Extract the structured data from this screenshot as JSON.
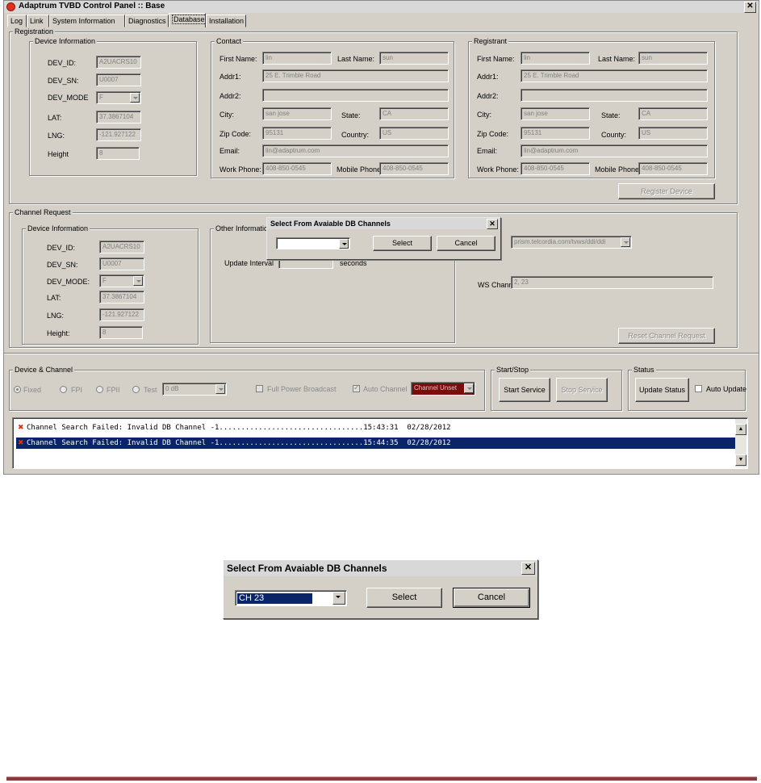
{
  "window": {
    "title": "Adaptrum TVBD Control Panel :: Base",
    "close_glyph": "✕",
    "tabs": [
      {
        "label": "Log",
        "active": false
      },
      {
        "label": "Link",
        "active": false
      },
      {
        "label": "System Information",
        "active": false
      },
      {
        "label": "Diagnostics",
        "active": false
      },
      {
        "label": "Database",
        "active": true
      },
      {
        "label": "Installation",
        "active": false
      }
    ]
  },
  "registration": {
    "group_label": "Registration",
    "device_info": {
      "label": "Device Information",
      "fields": [
        {
          "label": "DEV_ID:",
          "value": "A2UACRS10"
        },
        {
          "label": "DEV_SN:",
          "value": "U0007"
        },
        {
          "label": "DEV_MODE",
          "value": "F"
        },
        {
          "label": "LAT:",
          "value": "37.3867104"
        },
        {
          "label": "LNG:",
          "value": "-121.927122"
        },
        {
          "label": "Height",
          "value": "8"
        }
      ]
    },
    "contact": {
      "label": "Contact",
      "first_name_label": "First Name:",
      "first_name": "lin",
      "last_name_label": "Last Name:",
      "last_name": "sun",
      "addr1_label": "Addr1:",
      "addr1": "25 E. Trimble Road",
      "addr2_label": "Addr2:",
      "addr2": "",
      "city_label": "City:",
      "city": "san jose",
      "state_label": "State:",
      "state": "CA",
      "zip_label": "Zip Code:",
      "zip": "95131",
      "country_label": "Country:",
      "country": "US",
      "email_label": "Email:",
      "email": "lin@adaptrum.com",
      "work_phone_label": "Work Phone:",
      "work_phone": "408-850-0545",
      "mobile_phone_label": "Mobile Phone:",
      "mobile_phone": "408-850-0545"
    },
    "registrant": {
      "label": "Registrant",
      "first_name_label": "First Name:",
      "first_name": "lin",
      "last_name_label": "Last Name:",
      "last_name": "sun",
      "addr1_label": "Addr1:",
      "addr1": "25 E. Trimble Road",
      "addr2_label": "Addr2:",
      "addr2": "",
      "city_label": "City:",
      "city": "san jose",
      "state_label": "State:",
      "state": "CA",
      "zip_label": "Zip Code:",
      "zip": "95131",
      "country_label": "County:",
      "country": "US",
      "email_label": "Email:",
      "email": "lin@adaptrum.com",
      "work_phone_label": "Work Phone:",
      "work_phone": "408-850-0545",
      "mobile_phone_label": "Mobile Phone:",
      "mobile_phone": "408-850-0545"
    },
    "register_button": "Register Device"
  },
  "channel_request": {
    "group_label": "Channel Request",
    "device_info": {
      "label": "Device Information",
      "fields": [
        {
          "label": "DEV_ID:",
          "value": "A2UACRS10"
        },
        {
          "label": "DEV_SN:",
          "value": "U0007"
        },
        {
          "label": "DEV_MODE:",
          "value": "F"
        },
        {
          "label": "LAT:",
          "value": "37.3867104"
        },
        {
          "label": "LNG:",
          "value": "-121.927122"
        },
        {
          "label": "Height:",
          "value": "8"
        }
      ]
    },
    "other_info_label": "Other Information",
    "update_interval_label": "Update Interval",
    "update_interval_unit": "seconds",
    "db_url": "prism.telcordia.com/tvws/ddi/ddi",
    "ws_channels_label": "WS Channels:",
    "ws_channels": "2, 23",
    "reset_button": "Reset Channel Request"
  },
  "popup_small": {
    "title": "Select From Avaiable DB Channels",
    "select_value": "",
    "select_button": "Select",
    "cancel_button": "Cancel"
  },
  "device_channel": {
    "group_label": "Device & Channel",
    "radios": [
      "Fixed",
      "FPI",
      "FPII",
      "Test"
    ],
    "selected_radio": "Fixed",
    "power": "0 dB",
    "full_power_label": "Full Power Broadcast",
    "auto_channel_label": "Auto Channel",
    "channel_value": "Channel Unset"
  },
  "start_stop": {
    "group_label": "Start/Stop",
    "start_button": "Start Service",
    "stop_button": "Stop Service"
  },
  "status": {
    "group_label": "Status",
    "update_button": "Update Status",
    "auto_update_label": "Auto Update"
  },
  "log": {
    "rows": [
      {
        "text": "Channel Search Failed: Invalid DB Channel -1.................................15:43:31  02/28/2012",
        "selected": false
      },
      {
        "text": "Channel Search Failed: Invalid DB Channel -1.................................15:44:35  02/28/2012",
        "selected": true
      }
    ]
  },
  "popup_large": {
    "title": "Select From Avaiable DB Channels",
    "select_value": "CH 23",
    "select_button": "Select",
    "cancel_button": "Cancel"
  }
}
